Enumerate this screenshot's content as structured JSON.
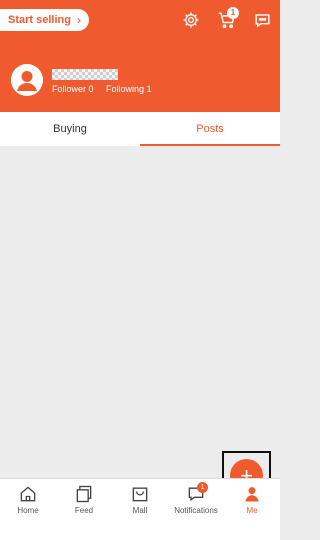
{
  "header": {
    "start_selling": "Start selling",
    "cart_badge": "1",
    "follower": "Follower 0",
    "following": "Following 1"
  },
  "tabs": [
    {
      "label": "Buying",
      "active": false
    },
    {
      "label": "Posts",
      "active": true
    }
  ],
  "fab": {
    "symbol": "+"
  },
  "bottom_nav": [
    {
      "label": "Home",
      "icon": "home-icon"
    },
    {
      "label": "Feed",
      "icon": "feed-icon"
    },
    {
      "label": "Mall",
      "icon": "mall-icon"
    },
    {
      "label": "Notifications",
      "icon": "notifications-icon",
      "badge": "1"
    },
    {
      "label": "Me",
      "icon": "me-icon",
      "active": true
    }
  ],
  "colors": {
    "accent": "#ef5a2e"
  }
}
